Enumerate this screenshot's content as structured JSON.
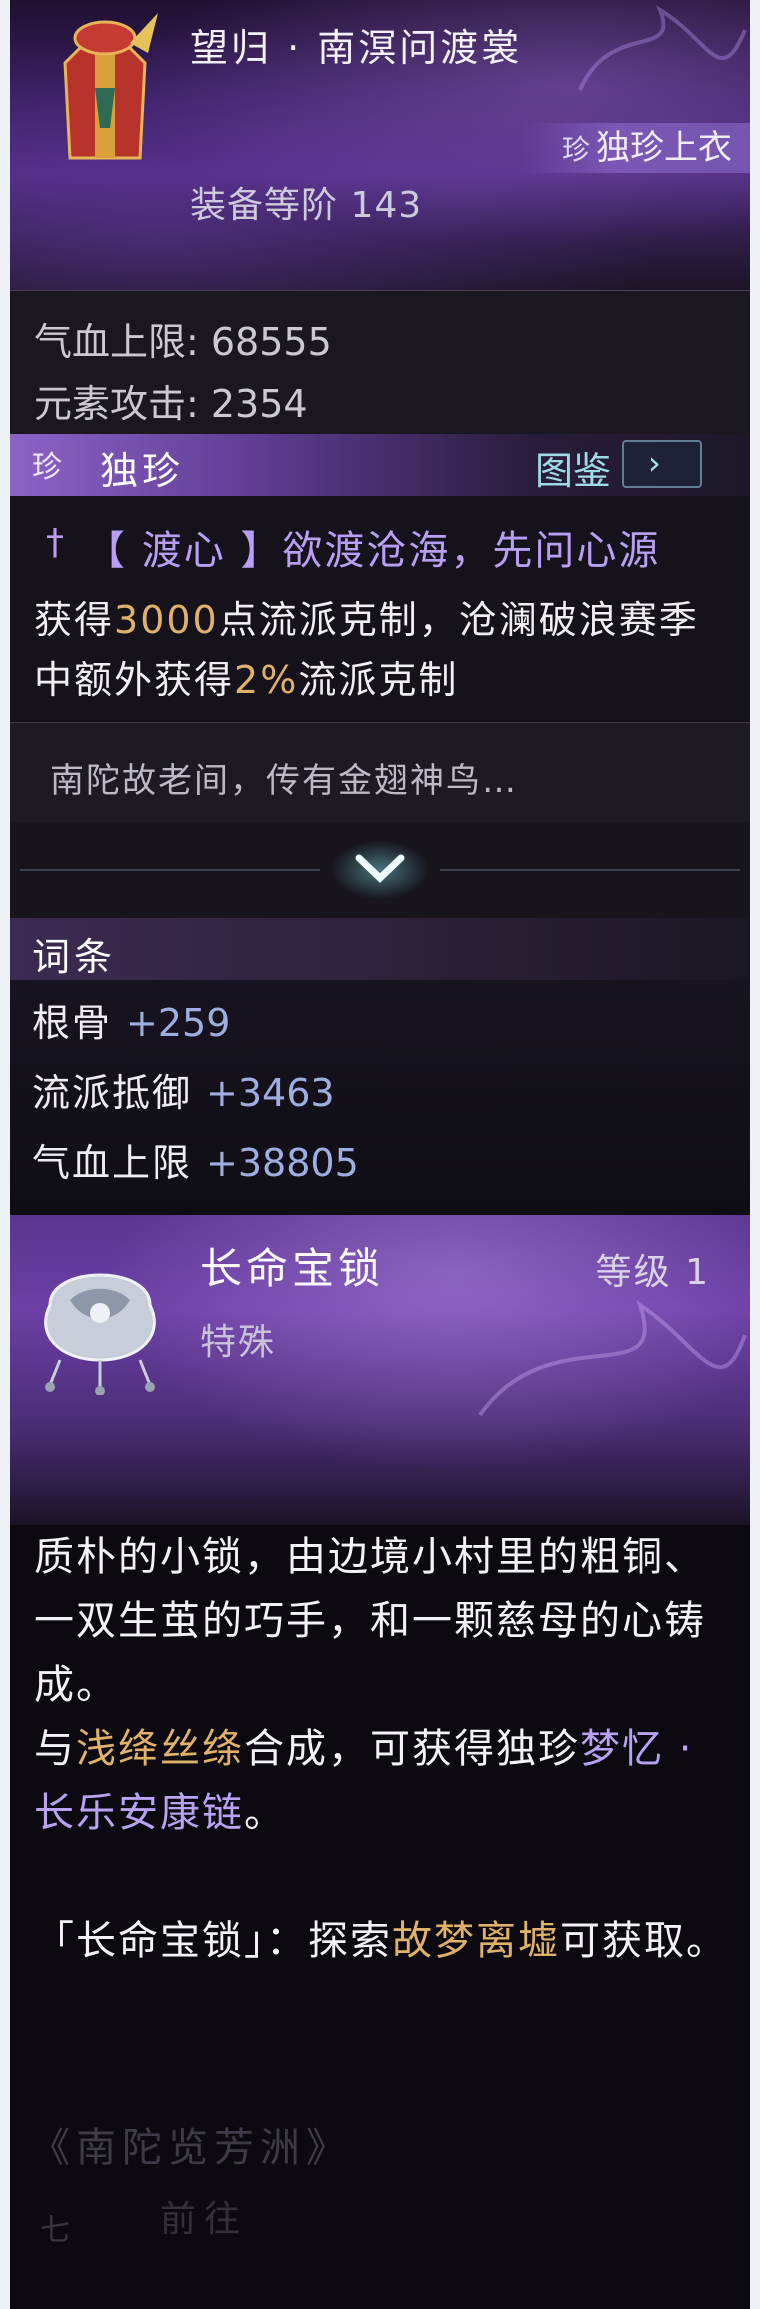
{
  "item": {
    "name": "望归 · 南溟问渡裳",
    "tier_label": "装备等阶 143",
    "slot_glyph": "珍",
    "slot_label": "独珍上衣",
    "stats": [
      {
        "label": "气血上限: 68555"
      },
      {
        "label": "元素攻击: 2354"
      }
    ],
    "rarity_glyph": "珍",
    "rarity_label": "独珍",
    "codex_label": "图鉴",
    "effect": {
      "title": "【 渡心 】欲渡沧海，先问心源",
      "desc_1": "获得",
      "desc_value_1": "3000",
      "desc_2": "点流派克制，沧澜破浪赛季中额外获得",
      "desc_value_2": "2%",
      "desc_3": "流派克制"
    },
    "lore": "南陀故老间，传有金翅神鸟…",
    "affix_header": "词条",
    "affixes": [
      {
        "name": "根骨",
        "value": "+259"
      },
      {
        "name": "流派抵御",
        "value": "+3463"
      },
      {
        "name": "气血上限",
        "value": "+38805"
      }
    ]
  },
  "material": {
    "name": "长命宝锁",
    "level": "等级 1",
    "type": "特殊",
    "desc_line": "质朴的小锁，由边境小村里的粗铜、一双生茧的巧手，和一颗慈母的心铸成。",
    "craft_1": "与",
    "craft_item": "浅绛丝绦",
    "craft_2": "合成，可获得独珍",
    "craft_result": "梦忆 · 长乐安康链",
    "craft_3": "。",
    "source_1": "「长命宝锁」：探索",
    "source_place": "故梦离墟",
    "source_2": "可获取。"
  },
  "background_text": {
    "ghost_title": "《南陀览芳洲》",
    "ghost_button": "前往",
    "ghost_mark": "七"
  },
  "colors": {
    "gold": "#e0b169",
    "purple_highlight": "#b9a1f3",
    "stat_value_blue": "#9eaee0",
    "accent_cyan": "#9edbe6"
  }
}
